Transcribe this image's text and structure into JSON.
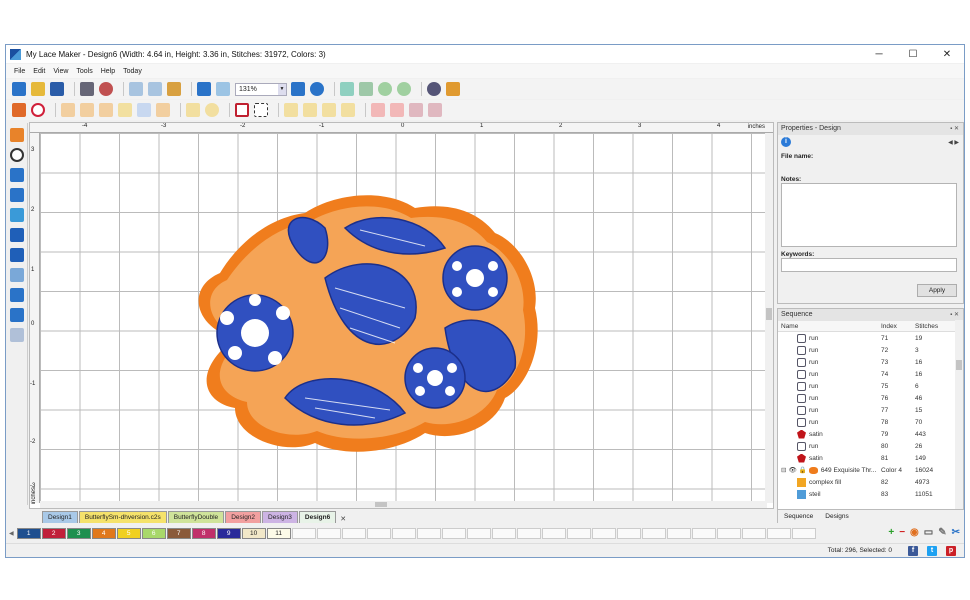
{
  "window": {
    "title": "My Lace Maker - Design6 (Width: 4.64 in, Height: 3.36 in, Stitches: 31972, Colors: 3)"
  },
  "menu": [
    "File",
    "Edit",
    "View",
    "Tools",
    "Help",
    "Today"
  ],
  "toolbar": {
    "zoom": "131%"
  },
  "ruler": {
    "top_ticks": [
      "-4",
      "-3",
      "-2",
      "-1",
      "0",
      "1",
      "2",
      "3",
      "4"
    ],
    "left_ticks": [
      "3",
      "2",
      "1",
      "0",
      "-1",
      "-2",
      "-3"
    ],
    "unit": "inches"
  },
  "properties": {
    "title": "Properties - Design",
    "file_name_label": "File name:",
    "notes_label": "Notes:",
    "keywords_label": "Keywords:",
    "apply": "Apply"
  },
  "sequence": {
    "title": "Sequence",
    "columns": [
      "Name",
      "Index",
      "Stitches"
    ],
    "rows": [
      {
        "icon": "run",
        "name": "run",
        "index": "71",
        "stitches": "19"
      },
      {
        "icon": "run",
        "name": "run",
        "index": "72",
        "stitches": "3"
      },
      {
        "icon": "run",
        "name": "run",
        "index": "73",
        "stitches": "16"
      },
      {
        "icon": "run",
        "name": "run",
        "index": "74",
        "stitches": "16"
      },
      {
        "icon": "run",
        "name": "run",
        "index": "75",
        "stitches": "6"
      },
      {
        "icon": "run",
        "name": "run",
        "index": "76",
        "stitches": "46"
      },
      {
        "icon": "run",
        "name": "run",
        "index": "77",
        "stitches": "15"
      },
      {
        "icon": "run",
        "name": "run",
        "index": "78",
        "stitches": "70"
      },
      {
        "icon": "satin",
        "name": "satin",
        "index": "79",
        "stitches": "443"
      },
      {
        "icon": "run",
        "name": "run",
        "index": "80",
        "stitches": "26"
      },
      {
        "icon": "satin",
        "name": "satin",
        "index": "81",
        "stitches": "149"
      },
      {
        "icon": "thread",
        "name": "649 Exquisite Thr...",
        "index": "Color 4",
        "stitches": "16024"
      },
      {
        "icon": "fill",
        "name": "complex fill",
        "index": "82",
        "stitches": "4973"
      },
      {
        "icon": "steil",
        "name": "steil",
        "index": "83",
        "stitches": "11051"
      }
    ]
  },
  "panel_tabs": [
    "Sequence",
    "Designs"
  ],
  "doc_tabs": [
    {
      "label": "Design1",
      "color": "#a9c9e8"
    },
    {
      "label": "ButterflySm-dhversion.c2s",
      "color": "#f5e26b"
    },
    {
      "label": "ButterflyDouble",
      "color": "#cfe39a"
    },
    {
      "label": "Design2",
      "color": "#f2a0a0"
    },
    {
      "label": "Design3",
      "color": "#cdb4e4"
    },
    {
      "label": "Design6",
      "color": "#e8f3e8"
    }
  ],
  "colors": [
    {
      "n": "1",
      "hex": "#1f4f8f"
    },
    {
      "n": "2",
      "hex": "#c0203a"
    },
    {
      "n": "3",
      "hex": "#1f8f4f"
    },
    {
      "n": "4",
      "hex": "#e0781c"
    },
    {
      "n": "5",
      "hex": "#f0d020"
    },
    {
      "n": "6",
      "hex": "#a8d86a"
    },
    {
      "n": "7",
      "hex": "#8a5a3a"
    },
    {
      "n": "8",
      "hex": "#c0306a"
    },
    {
      "n": "9",
      "hex": "#2a2a9a"
    },
    {
      "n": "10",
      "hex": "#f2e8c8"
    },
    {
      "n": "11",
      "hex": "#fdfbe8"
    }
  ],
  "status": {
    "text": "Total: 296, Selected: 0"
  },
  "accent": {
    "blue": "#3050c0",
    "orange": "#f07d1d"
  }
}
